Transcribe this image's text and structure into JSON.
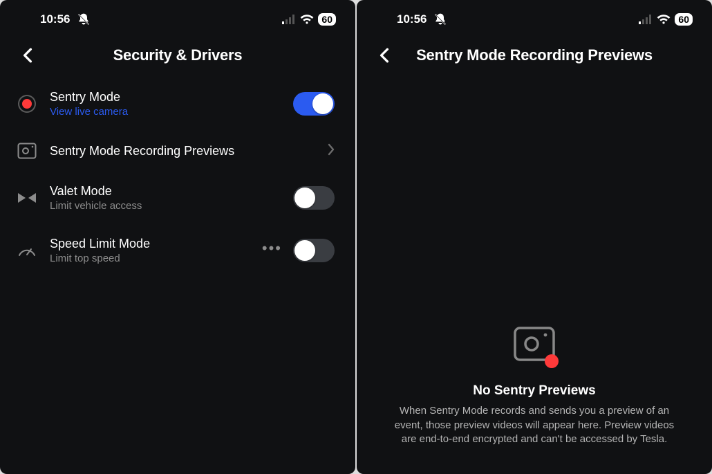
{
  "status": {
    "time": "10:56",
    "battery": "60"
  },
  "screen1": {
    "header": {
      "title": "Security & Drivers"
    },
    "items": [
      {
        "title": "Sentry Mode",
        "sub": "View live camera",
        "toggle": true
      },
      {
        "title": "Sentry Mode Recording Previews"
      },
      {
        "title": "Valet Mode",
        "sub": "Limit vehicle access",
        "toggle": false
      },
      {
        "title": "Speed Limit Mode",
        "sub": "Limit top speed",
        "toggle": false
      }
    ]
  },
  "screen2": {
    "header": {
      "title": "Sentry Mode Recording Previews"
    },
    "empty": {
      "title": "No Sentry Previews",
      "desc": "When Sentry Mode records and sends you a preview of an event, those preview videos will appear here. Preview videos are end-to-end encrypted and can't be accessed by Tesla."
    }
  }
}
